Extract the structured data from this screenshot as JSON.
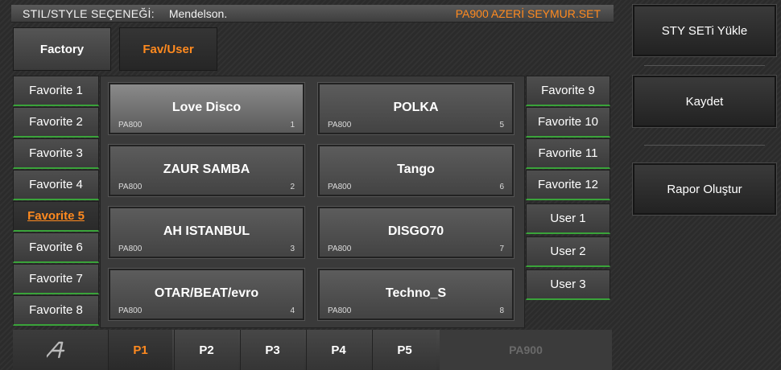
{
  "header": {
    "label": "STIL/STYLE SEÇENEĞİ:",
    "value": "Mendelson.",
    "set_name": "PA900 AZERİ SEYMUR.SET"
  },
  "tabs": [
    {
      "label": "Factory",
      "active": false
    },
    {
      "label": "Fav/User",
      "active": true
    }
  ],
  "left_banks": [
    {
      "label": "Favorite 1"
    },
    {
      "label": "Favorite 2"
    },
    {
      "label": "Favorite 3"
    },
    {
      "label": "Favorite 4"
    },
    {
      "label": "Favorite 5",
      "active": true
    },
    {
      "label": "Favorite 6"
    },
    {
      "label": "Favorite 7"
    },
    {
      "label": "Favorite 8"
    }
  ],
  "right_banks": [
    {
      "label": "Favorite 9"
    },
    {
      "label": "Favorite 10"
    },
    {
      "label": "Favorite 11"
    },
    {
      "label": "Favorite 12"
    },
    {
      "label": "User 1"
    },
    {
      "label": "User 2"
    },
    {
      "label": "User 3"
    }
  ],
  "styles": [
    {
      "name": "Love Disco",
      "bank": "PA800",
      "num": "1",
      "selected": true
    },
    {
      "name": "ZAUR SAMBA",
      "bank": "PA800",
      "num": "2"
    },
    {
      "name": "AH ISTANBUL",
      "bank": "PA800",
      "num": "3"
    },
    {
      "name": "OTAR/BEAT/evro",
      "bank": "PA800",
      "num": "4"
    },
    {
      "name": "POLKA",
      "bank": "PA800",
      "num": "5"
    },
    {
      "name": "Tango",
      "bank": "PA800",
      "num": "6"
    },
    {
      "name": "DISGO70",
      "bank": "PA800",
      "num": "7"
    },
    {
      "name": "Techno_S",
      "bank": "PA800",
      "num": "8"
    }
  ],
  "pages": [
    {
      "label": "P1",
      "active": true
    },
    {
      "label": "P2"
    },
    {
      "label": "P3"
    },
    {
      "label": "P4"
    },
    {
      "label": "P5"
    }
  ],
  "model_label": "PA900",
  "actions": {
    "load_label": "STY  SETi  Yükle",
    "save_label": "Kaydet",
    "report_label": "Rapor Oluştur"
  },
  "colors": {
    "accent": "#ff8a1f",
    "bank_underline": "#3aa33a"
  },
  "logo_icon": "korg-a-logo-icon"
}
